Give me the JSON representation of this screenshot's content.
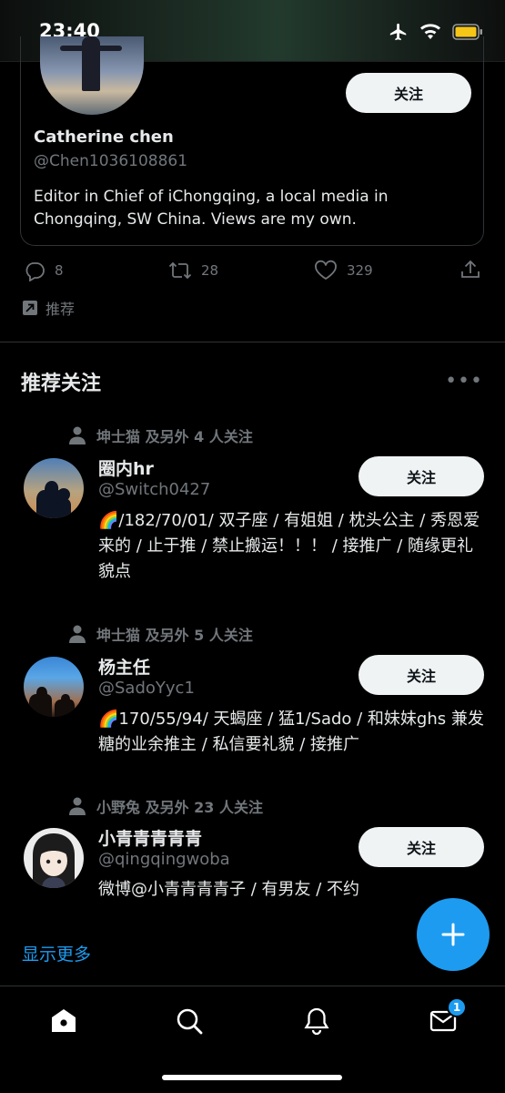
{
  "status_bar": {
    "time": "23:40"
  },
  "profile_card": {
    "follow_label": "关注",
    "name": "Catherine chen",
    "handle": "@Chen1036108861",
    "bio": "Editor in Chief of iChongqing, a local media in Chongqing, SW China. Views are my own."
  },
  "tweet_actions": {
    "replies": "8",
    "retweets": "28",
    "likes": "329"
  },
  "promoted_label": "推荐",
  "who_to_follow": {
    "title": "推荐关注",
    "items": [
      {
        "social_context": "坤士猫 及另外 4 人关注",
        "name": "圈内hr",
        "handle": "@Switch0427",
        "bio": "🌈/182/70/01/ 双子座 / 有姐姐 / 枕头公主 / 秀恩爱来的 / 止于推 / 禁止搬运！！！ / 接推广 / 随缘更礼貌点",
        "follow_label": "关注"
      },
      {
        "social_context": "坤士猫 及另外 5 人关注",
        "name": "杨主任",
        "handle": "@SadoYyc1",
        "bio": "🌈170/55/94/ 天蝎座 / 猛1/Sado / 和妹妹ghs 兼发糖的业余推主 / 私信要礼貌 / 接推广",
        "follow_label": "关注"
      },
      {
        "social_context": "小野兔 及另外 23 人关注",
        "name": "小青青青青青",
        "handle": "@qingqingwoba",
        "bio": "微博@小青青青青子 / 有男友 / 不约",
        "follow_label": "关注"
      }
    ],
    "show_more": "显示更多"
  },
  "bottom_nav": {
    "messages_badge": "1"
  },
  "colors": {
    "accent": "#1d9bf0",
    "background": "#000000",
    "secondary_text": "#71767b"
  }
}
